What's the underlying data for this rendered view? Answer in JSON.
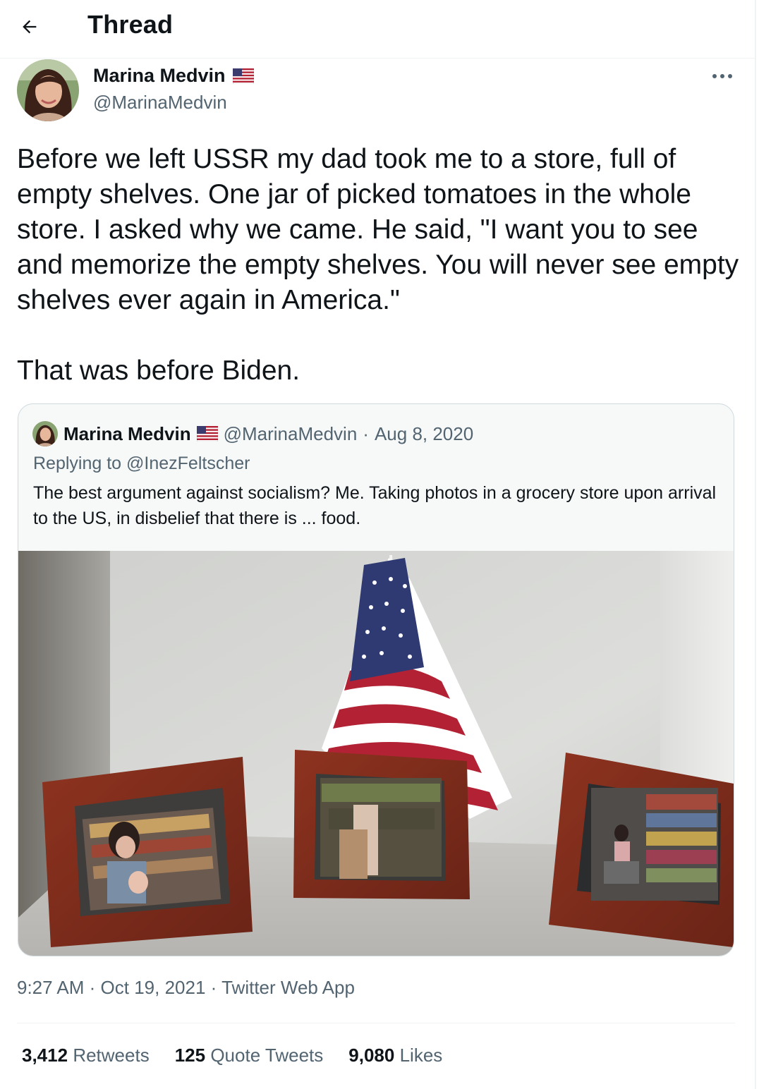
{
  "header": {
    "title": "Thread",
    "back_icon": "arrow-left-icon"
  },
  "author": {
    "name": "Marina Medvin",
    "handle": "@MarinaMedvin",
    "badge_icon": "us-flag-icon"
  },
  "tweet": {
    "paragraphs": [
      "Before we left USSR my dad took me to a store, full of empty shelves. One jar of picked tomatoes in the whole store. I asked why we came. He said, \"I want you to see and memorize the empty shelves. You will never see empty shelves ever again in America.\"",
      "That was before Biden."
    ]
  },
  "quote": {
    "name": "Marina Medvin",
    "handle": "@MarinaMedvin",
    "separator": "·",
    "date": "Aug 8, 2020",
    "replying_to": "Replying to @InezFeltscher",
    "text": "The best argument against socialism? Me. Taking photos in a grocery store upon arrival to the US, in disbelief that there is ... food."
  },
  "meta": {
    "time": "9:27 AM",
    "date": "Oct 19, 2021",
    "source": "Twitter Web App",
    "separator": "·"
  },
  "stats": [
    {
      "count": "3,412",
      "label": "Retweets"
    },
    {
      "count": "125",
      "label": "Quote Tweets"
    },
    {
      "count": "9,080",
      "label": "Likes"
    }
  ],
  "colors": {
    "text": "#0f1419",
    "secondary": "#536471",
    "border": "#cfd9de",
    "divider": "#eff3f4",
    "quote_bg": "#f7f9f9"
  }
}
